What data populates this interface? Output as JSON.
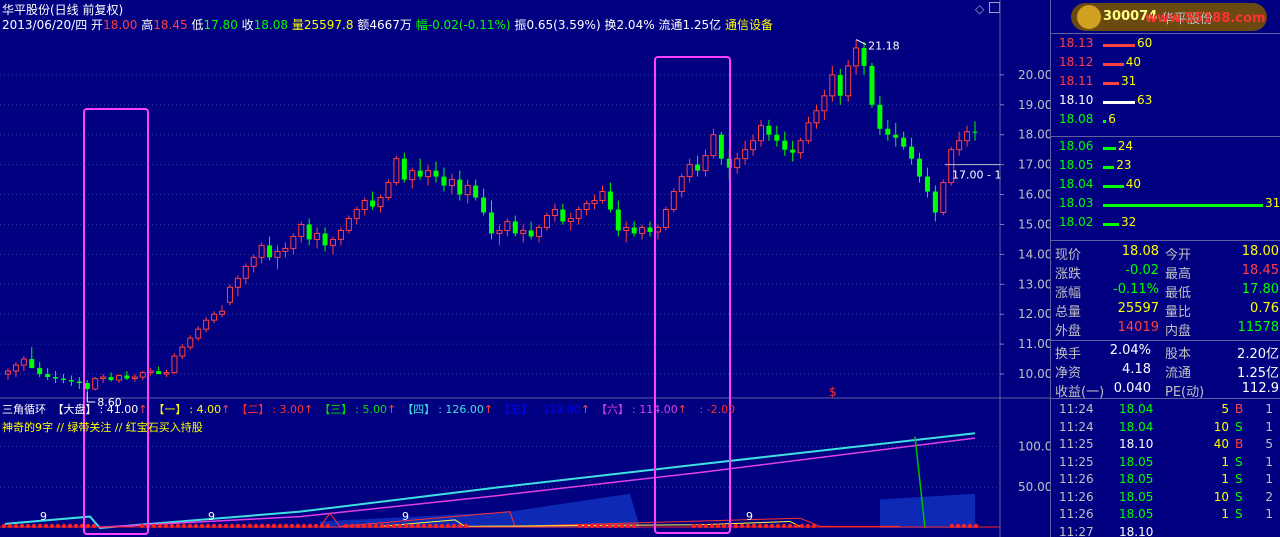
{
  "header": {
    "stock_title": "华平股份(日线 前复权)",
    "date": "2013/06/20/四",
    "open_label": "开",
    "open": "18.00",
    "high_label": "高",
    "high": "18.45",
    "low_label": "低",
    "low": "17.80",
    "close_label": "收",
    "close": "18.08",
    "volume_label": "量",
    "volume": "25597.8",
    "amount_label": "额",
    "amount": "4667万",
    "change_label": "幅",
    "change": "-0.02(-0.11%)",
    "amplitude": "振0.65(3.59%)",
    "turnover": "换2.04%",
    "float_cap": "流通1.25亿",
    "sector": "通信设备"
  },
  "window_controls": {
    "diamond": "◇",
    "restore": "▢"
  },
  "chart_data": {
    "type": "candlestick",
    "y_ticks": [
      "20.00",
      "19.00",
      "18.00",
      "17.00",
      "16.00",
      "15.00",
      "14.00",
      "13.00",
      "12.00",
      "11.00",
      "10.00"
    ],
    "ylim": [
      9.3,
      21.5
    ],
    "high_annotation": "21.18",
    "low_annotation": "8.60",
    "last_price_label": "17.00 - 1",
    "candles": [
      [
        10.0,
        10.2,
        9.8,
        10.1
      ],
      [
        10.1,
        10.4,
        9.9,
        10.3
      ],
      [
        10.3,
        10.6,
        10.1,
        10.5
      ],
      [
        10.5,
        10.9,
        10.3,
        10.2
      ],
      [
        10.2,
        10.4,
        9.9,
        10.0
      ],
      [
        10.0,
        10.2,
        9.8,
        9.9
      ],
      [
        9.9,
        10.1,
        9.7,
        9.85
      ],
      [
        9.85,
        10.0,
        9.7,
        9.8
      ],
      [
        9.8,
        9.95,
        9.6,
        9.75
      ],
      [
        9.75,
        9.9,
        9.5,
        9.7
      ],
      [
        9.7,
        9.8,
        9.4,
        9.5
      ],
      [
        9.5,
        9.9,
        9.45,
        9.85
      ],
      [
        9.85,
        10.0,
        9.7,
        9.9
      ],
      [
        9.9,
        10.05,
        9.75,
        9.8
      ],
      [
        9.8,
        10.0,
        9.7,
        9.95
      ],
      [
        9.95,
        10.1,
        9.8,
        9.85
      ],
      [
        9.85,
        10.0,
        9.75,
        9.9
      ],
      [
        9.9,
        10.1,
        9.8,
        10.05
      ],
      [
        10.05,
        10.2,
        9.95,
        10.1
      ],
      [
        10.1,
        10.25,
        10.0,
        10.0
      ],
      [
        10.0,
        10.15,
        9.9,
        10.05
      ],
      [
        10.05,
        10.7,
        10.0,
        10.6
      ],
      [
        10.6,
        11.0,
        10.5,
        10.9
      ],
      [
        10.9,
        11.3,
        10.8,
        11.2
      ],
      [
        11.2,
        11.6,
        11.1,
        11.5
      ],
      [
        11.5,
        11.9,
        11.4,
        11.8
      ],
      [
        11.8,
        12.1,
        11.7,
        12.0
      ],
      [
        12.0,
        12.3,
        11.9,
        12.1
      ],
      [
        12.4,
        13.0,
        12.3,
        12.9
      ],
      [
        12.9,
        13.3,
        12.6,
        13.2
      ],
      [
        13.2,
        13.7,
        13.0,
        13.6
      ],
      [
        13.6,
        14.0,
        13.4,
        13.9
      ],
      [
        13.9,
        14.4,
        13.7,
        14.3
      ],
      [
        14.3,
        14.6,
        13.8,
        13.9
      ],
      [
        13.9,
        14.3,
        13.5,
        14.1
      ],
      [
        14.1,
        14.4,
        13.9,
        14.2
      ],
      [
        14.2,
        14.7,
        14.0,
        14.6
      ],
      [
        14.6,
        15.1,
        14.4,
        15.0
      ],
      [
        15.0,
        15.2,
        14.3,
        14.5
      ],
      [
        14.5,
        14.9,
        14.2,
        14.7
      ],
      [
        14.7,
        14.9,
        14.1,
        14.3
      ],
      [
        14.3,
        14.6,
        14.0,
        14.5
      ],
      [
        14.5,
        14.9,
        14.3,
        14.8
      ],
      [
        14.8,
        15.3,
        14.7,
        15.2
      ],
      [
        15.2,
        15.6,
        15.0,
        15.5
      ],
      [
        15.5,
        15.9,
        15.3,
        15.8
      ],
      [
        15.8,
        16.1,
        15.5,
        15.6
      ],
      [
        15.6,
        16.0,
        15.4,
        15.9
      ],
      [
        15.9,
        16.5,
        15.8,
        16.4
      ],
      [
        16.4,
        17.3,
        16.3,
        17.2
      ],
      [
        17.2,
        17.4,
        16.4,
        16.5
      ],
      [
        16.5,
        16.9,
        16.2,
        16.8
      ],
      [
        16.8,
        17.2,
        16.5,
        16.6
      ],
      [
        16.6,
        17.0,
        16.3,
        16.8
      ],
      [
        16.8,
        17.1,
        16.4,
        16.6
      ],
      [
        16.6,
        16.9,
        16.1,
        16.3
      ],
      [
        16.3,
        16.7,
        16.0,
        16.5
      ],
      [
        16.5,
        16.8,
        15.8,
        16.0
      ],
      [
        16.0,
        16.5,
        15.7,
        16.3
      ],
      [
        16.3,
        16.5,
        15.8,
        15.9
      ],
      [
        15.9,
        16.2,
        15.3,
        15.4
      ],
      [
        15.4,
        15.8,
        14.5,
        14.7
      ],
      [
        14.7,
        15.0,
        14.3,
        14.8
      ],
      [
        14.8,
        15.2,
        14.6,
        15.1
      ],
      [
        15.1,
        15.3,
        14.6,
        14.7
      ],
      [
        14.7,
        15.0,
        14.4,
        14.8
      ],
      [
        14.8,
        15.1,
        14.5,
        14.6
      ],
      [
        14.6,
        15.0,
        14.4,
        14.9
      ],
      [
        14.9,
        15.4,
        14.8,
        15.3
      ],
      [
        15.3,
        15.7,
        15.1,
        15.5
      ],
      [
        15.5,
        15.7,
        15.0,
        15.1
      ],
      [
        15.1,
        15.4,
        14.8,
        15.2
      ],
      [
        15.2,
        15.6,
        15.0,
        15.5
      ],
      [
        15.5,
        15.8,
        15.3,
        15.7
      ],
      [
        15.7,
        16.0,
        15.5,
        15.8
      ],
      [
        15.8,
        16.3,
        15.7,
        16.1
      ],
      [
        16.1,
        16.4,
        15.4,
        15.5
      ],
      [
        15.5,
        15.8,
        14.6,
        14.8
      ],
      [
        14.8,
        15.1,
        14.4,
        14.9
      ],
      [
        14.9,
        15.1,
        14.6,
        14.7
      ],
      [
        14.7,
        15.0,
        14.5,
        14.9
      ],
      [
        14.9,
        15.1,
        14.6,
        14.75
      ],
      [
        14.75,
        15.0,
        14.5,
        14.9
      ],
      [
        14.9,
        15.6,
        14.8,
        15.5
      ],
      [
        15.5,
        16.2,
        15.4,
        16.1
      ],
      [
        16.1,
        16.7,
        15.9,
        16.6
      ],
      [
        16.6,
        17.2,
        16.4,
        17.0
      ],
      [
        17.0,
        17.3,
        16.6,
        16.8
      ],
      [
        16.8,
        17.5,
        16.6,
        17.3
      ],
      [
        17.3,
        18.2,
        17.2,
        18.0
      ],
      [
        18.0,
        18.1,
        17.0,
        17.2
      ],
      [
        17.2,
        17.5,
        16.5,
        16.9
      ],
      [
        16.9,
        17.4,
        16.7,
        17.2
      ],
      [
        17.2,
        17.8,
        17.0,
        17.5
      ],
      [
        17.5,
        18.0,
        17.3,
        17.8
      ],
      [
        17.8,
        18.5,
        17.6,
        18.3
      ],
      [
        18.3,
        18.5,
        17.8,
        18.0
      ],
      [
        18.0,
        18.3,
        17.6,
        17.8
      ],
      [
        17.8,
        18.1,
        17.3,
        17.5
      ],
      [
        17.5,
        17.8,
        17.1,
        17.4
      ],
      [
        17.4,
        17.9,
        17.2,
        17.8
      ],
      [
        17.8,
        18.6,
        17.7,
        18.4
      ],
      [
        18.4,
        19.0,
        18.2,
        18.8
      ],
      [
        18.8,
        19.5,
        18.5,
        19.3
      ],
      [
        19.3,
        20.3,
        19.1,
        20.0
      ],
      [
        20.0,
        20.2,
        19.0,
        19.3
      ],
      [
        19.3,
        20.5,
        19.1,
        20.3
      ],
      [
        20.3,
        21.18,
        20.0,
        20.9
      ],
      [
        20.9,
        21.1,
        20.0,
        20.3
      ],
      [
        20.3,
        20.4,
        18.9,
        19.0
      ],
      [
        19.0,
        19.3,
        18.0,
        18.2
      ],
      [
        18.2,
        18.5,
        17.8,
        18.0
      ],
      [
        18.0,
        18.4,
        17.6,
        17.9
      ],
      [
        17.9,
        18.1,
        17.5,
        17.6
      ],
      [
        17.6,
        17.9,
        17.0,
        17.2
      ],
      [
        17.2,
        17.4,
        16.4,
        16.6
      ],
      [
        16.6,
        16.9,
        15.9,
        16.1
      ],
      [
        16.1,
        16.3,
        15.1,
        15.4
      ],
      [
        15.4,
        16.5,
        15.3,
        16.4
      ],
      [
        16.4,
        17.6,
        16.3,
        17.5
      ],
      [
        17.5,
        18.1,
        17.3,
        17.8
      ],
      [
        17.8,
        18.3,
        17.6,
        18.1
      ],
      [
        18.1,
        18.45,
        17.8,
        18.08
      ]
    ]
  },
  "indicator": {
    "name": "三角循环",
    "items": [
      {
        "label": "【大盘】",
        "value": ": 41.00",
        "arrow": "↑",
        "color": "#ffffff"
      },
      {
        "label": "【一】",
        "value": ": 4.00",
        "arrow": "↑",
        "color": "#ffff00"
      },
      {
        "label": "【二】",
        "value": ": 3.00",
        "arrow": "↑",
        "color": "#ff3030"
      },
      {
        "label": "【三】",
        "value": ": 5.00",
        "arrow": "↑",
        "color": "#00e000"
      },
      {
        "label": "【四】",
        "value": ": 126.00",
        "arrow": "↑",
        "color": "#40e0e0"
      },
      {
        "label": "【五】",
        "value": ": 119.00",
        "arrow": "↑",
        "color": "#0000ff"
      },
      {
        "label": "【六】",
        "value": ": 114.00",
        "arrow": "↑",
        "color": "#e040e0"
      }
    ],
    "extra": ": -2.00",
    "note": "神奇的9字 // 绿带关注 // 红宝石买入持股",
    "y_ticks": [
      "100.0",
      "50.00"
    ],
    "nine_labels": [
      "9",
      "9",
      "9",
      "9"
    ],
    "signal_marker": "$"
  },
  "side": {
    "stock_code": "300074",
    "stock_name": "华平股份",
    "watermark": "www.55188.com",
    "asks": [
      {
        "price": "18.13",
        "vol": "60",
        "bar": 0.2
      },
      {
        "price": "18.12",
        "vol": "40",
        "bar": 0.13
      },
      {
        "price": "18.11",
        "vol": "31",
        "bar": 0.1
      },
      {
        "price": "18.10",
        "vol": "63",
        "bar": 0.2
      },
      {
        "price": "18.08",
        "vol": "6",
        "bar": 0.02
      }
    ],
    "bids": [
      {
        "price": "18.06",
        "vol": "24",
        "bar": 0.08
      },
      {
        "price": "18.05",
        "vol": "23",
        "bar": 0.07
      },
      {
        "price": "18.04",
        "vol": "40",
        "bar": 0.13
      },
      {
        "price": "18.03",
        "vol": "311",
        "bar": 1.0
      },
      {
        "price": "18.02",
        "vol": "32",
        "bar": 0.1
      }
    ],
    "stats": [
      {
        "l1": "现价",
        "v1": "18.08",
        "c1": "#ffff00",
        "l2": "今开",
        "v2": "18.00",
        "c2": "#ffff00"
      },
      {
        "l1": "涨跌",
        "v1": "-0.02",
        "c1": "#00ff00",
        "l2": "最高",
        "v2": "18.45",
        "c2": "#ff4040"
      },
      {
        "l1": "涨幅",
        "v1": "-0.11%",
        "c1": "#00ff00",
        "l2": "最低",
        "v2": "17.80",
        "c2": "#00ff00"
      },
      {
        "l1": "总量",
        "v1": "25597",
        "c1": "#ffff00",
        "l2": "量比",
        "v2": "0.76",
        "c2": "#ffff00"
      },
      {
        "l1": "外盘",
        "v1": "14019",
        "c1": "#ff4040",
        "l2": "内盘",
        "v2": "11578",
        "c2": "#00ff00"
      }
    ],
    "stats2": [
      {
        "l1": "换手",
        "v1": "2.04%",
        "l2": "股本",
        "v2": "2.20亿"
      },
      {
        "l1": "净资",
        "v1": "4.18",
        "l2": "流通",
        "v2": "1.25亿"
      },
      {
        "l1": "收益(一)",
        "v1": "0.040",
        "l2": "PE(动)",
        "v2": "112.9"
      }
    ],
    "ticks": [
      {
        "time": "11:24",
        "price": "18.04",
        "pc": "#00ff00",
        "vol": "5",
        "side": "B",
        "sc": "#ff4040",
        "n": "1"
      },
      {
        "time": "11:24",
        "price": "18.04",
        "pc": "#00ff00",
        "vol": "10",
        "side": "S",
        "sc": "#00ff00",
        "n": "1"
      },
      {
        "time": "11:25",
        "price": "18.10",
        "pc": "#ffffff",
        "vol": "40",
        "side": "B",
        "sc": "#ff4040",
        "n": "5"
      },
      {
        "time": "11:25",
        "price": "18.05",
        "pc": "#00ff00",
        "vol": "1",
        "side": "S",
        "sc": "#00ff00",
        "n": "1"
      },
      {
        "time": "11:26",
        "price": "18.05",
        "pc": "#00ff00",
        "vol": "1",
        "side": "S",
        "sc": "#00ff00",
        "n": "1"
      },
      {
        "time": "11:26",
        "price": "18.05",
        "pc": "#00ff00",
        "vol": "10",
        "side": "S",
        "sc": "#00ff00",
        "n": "2"
      },
      {
        "time": "11:26",
        "price": "18.05",
        "pc": "#00ff00",
        "vol": "1",
        "side": "S",
        "sc": "#00ff00",
        "n": "1"
      },
      {
        "time": "11:27",
        "price": "18.10",
        "pc": "#ffffff",
        "vol": "",
        "side": "",
        "sc": "#ffffff",
        "n": ""
      }
    ]
  }
}
